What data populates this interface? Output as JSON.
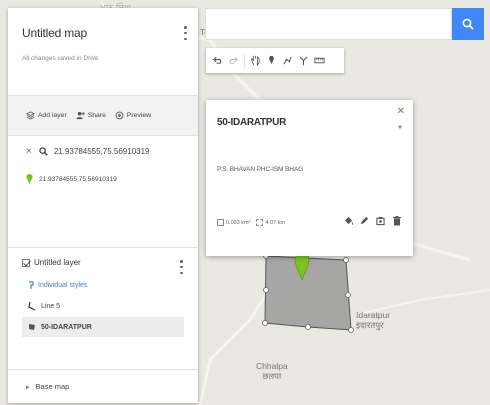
{
  "map_labels": {
    "top_left_faint": "ਮਾਨ ਸਿੰਘ",
    "tei": "Te",
    "idaratpur": "Idaratpur",
    "idaratpur_local": "इदारतपुर",
    "chhalpa": "Chhalpa",
    "chhalpa_local": "छलपा"
  },
  "panel": {
    "title": "Untitled map",
    "save_status": "All changes saved in Drive",
    "actions": {
      "add_layer": "Add layer",
      "share": "Share",
      "preview": "Preview"
    },
    "search_result": {
      "query": "21.93784555,75.56910319",
      "point": "21.93784555,75.56910319"
    },
    "layer": {
      "name": "Untitled layer",
      "styles": "Individual styles",
      "items": [
        {
          "label": "Line 5"
        },
        {
          "label": "50-IDARATPUR"
        }
      ]
    },
    "basemap": "Base map"
  },
  "search": {
    "value": "",
    "button_icon": "search-icon"
  },
  "toolbar": {
    "tools": [
      "undo-icon",
      "redo-icon",
      "hand-icon",
      "marker-icon",
      "draw-line-icon",
      "directions-icon",
      "ruler-icon"
    ]
  },
  "card": {
    "title": "50-IDARATPUR",
    "description": "P.S. BHAVAN PHC-ISM BHAG",
    "area": "0.093 km²",
    "perimeter": "4.07 km"
  },
  "colors": {
    "accent": "#4285f4",
    "marker": "#7cc51e",
    "polygon_fill": "#9e9e9e",
    "link": "#4a7fc7"
  }
}
